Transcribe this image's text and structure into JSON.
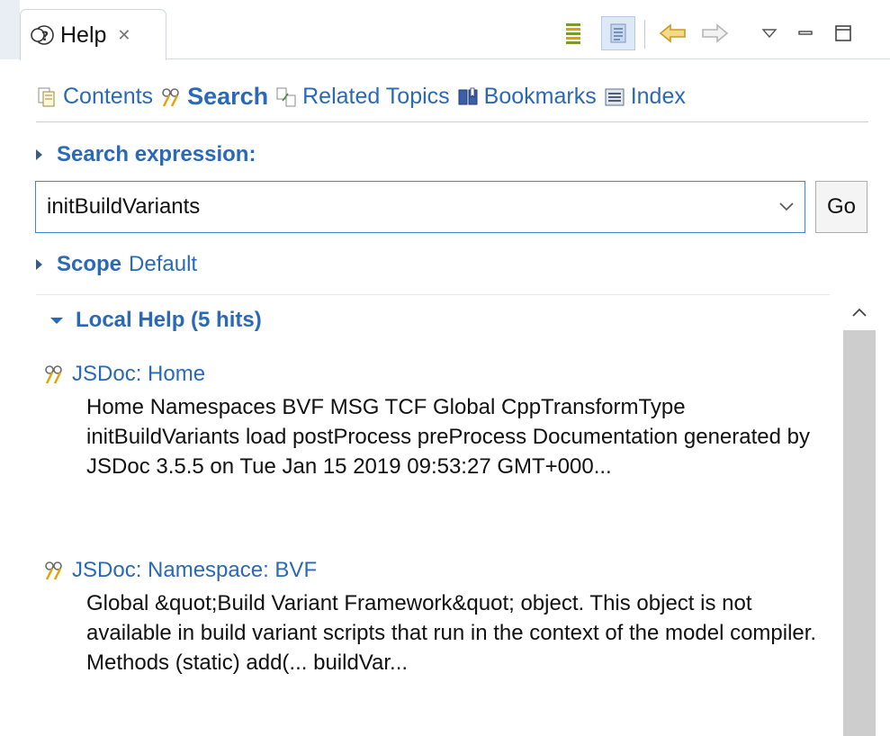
{
  "view": {
    "tab_title": "Help",
    "tab_close_glyph": "✕"
  },
  "toolbar": {
    "items": [
      "show-in-toc-icon",
      "show-all-topics-icon",
      "back-arrow-icon",
      "forward-arrow-icon",
      "view-menu-icon",
      "minimize-icon",
      "maximize-icon"
    ]
  },
  "nav": {
    "links": [
      {
        "label": "Contents",
        "icon": "contents-icon"
      },
      {
        "label": "Search",
        "icon": "search-icon",
        "active": true
      },
      {
        "label": "Related Topics",
        "icon": "related-topics-icon"
      },
      {
        "label": "Bookmarks",
        "icon": "bookmarks-icon"
      },
      {
        "label": "Index",
        "icon": "index-icon"
      }
    ]
  },
  "search": {
    "heading": "Search expression:",
    "value": "initBuildVariants",
    "go_label": "Go"
  },
  "scope": {
    "label": "Scope",
    "value": "Default"
  },
  "results": {
    "heading": "Local Help (5 hits)",
    "hits": [
      {
        "title": "JSDoc: Home",
        "snippet": "Home Namespaces BVF MSG TCF Global CppTransformType initBuildVariants load postProcess preProcess Documentation generated by JSDoc 3.5.5 on Tue Jan 15 2019 09:53:27 GMT+000..."
      },
      {
        "title": "JSDoc: Namespace: BVF",
        "snippet": "Global &quot;Build Variant Framework&quot; object. This object is not available in build variant scripts that run in the context of the model compiler. Methods (static) add(... buildVar..."
      }
    ]
  },
  "colors": {
    "link": "#2a69b7",
    "focus_border": "#3f86d8",
    "scroll_thumb": "#cdcdcd"
  }
}
